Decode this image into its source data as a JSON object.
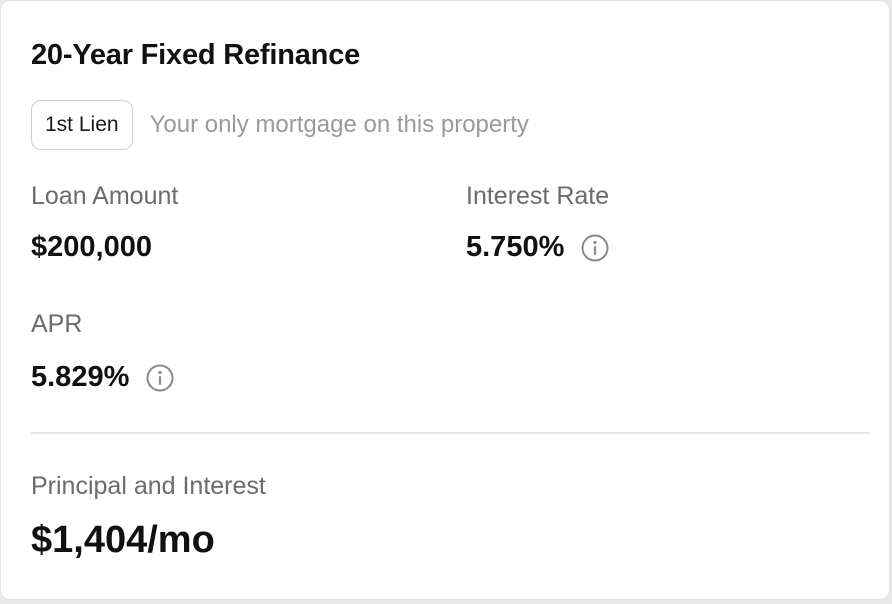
{
  "title": "20-Year Fixed Refinance",
  "lien": {
    "badge": "1st Lien",
    "description": "Your only mortgage on this property"
  },
  "loan_amount": {
    "label": "Loan Amount",
    "value": "$200,000"
  },
  "interest_rate": {
    "label": "Interest Rate",
    "value": "5.750%",
    "icon": "info-icon"
  },
  "apr": {
    "label": "APR",
    "value": "5.829%",
    "icon": "info-icon"
  },
  "principal_interest": {
    "label": "Principal and Interest",
    "value": "$1,404/mo"
  },
  "colors": {
    "text_primary": "#111111",
    "text_secondary": "#6b6b6b",
    "text_muted": "#9a9a9a",
    "border": "#cfcfcf"
  }
}
